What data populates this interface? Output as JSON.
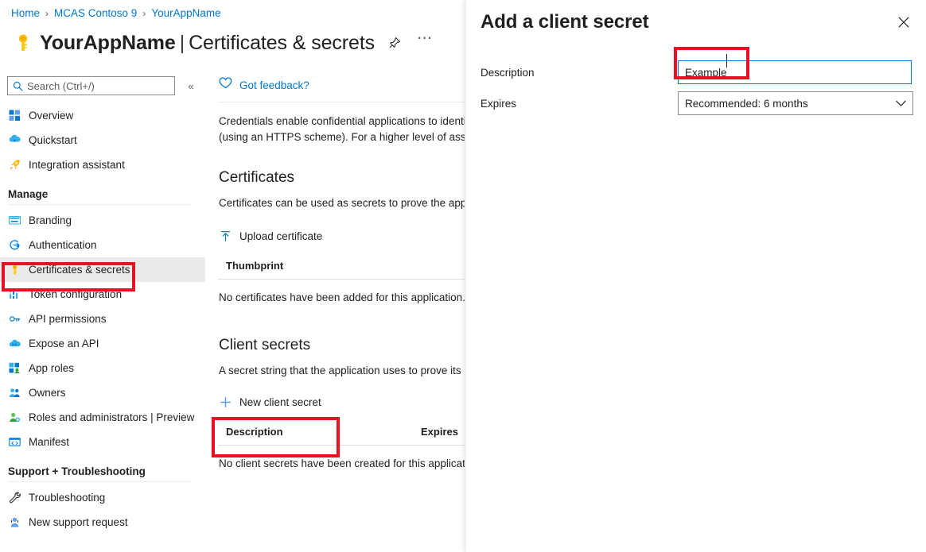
{
  "breadcrumb": [
    {
      "label": "Home"
    },
    {
      "label": "MCAS Contoso 9"
    },
    {
      "label": "YourAppName"
    }
  ],
  "breadcrumb_separator": "›",
  "header": {
    "app_name": "YourAppName",
    "divider": "|",
    "section": "Certificates & secrets"
  },
  "sidebar": {
    "search": {
      "placeholder": "Search (Ctrl+/)",
      "value": ""
    },
    "items": [
      {
        "label": "Overview",
        "icon": "overview-icon",
        "selected": false
      },
      {
        "label": "Quickstart",
        "icon": "quickstart-icon",
        "selected": false
      },
      {
        "label": "Integration assistant",
        "icon": "rocket-icon",
        "selected": false
      }
    ],
    "groups": [
      {
        "title": "Manage",
        "items": [
          {
            "label": "Branding",
            "icon": "branding-icon",
            "selected": false
          },
          {
            "label": "Authentication",
            "icon": "authentication-icon",
            "selected": false
          },
          {
            "label": "Certificates & secrets",
            "icon": "key-icon",
            "selected": true
          },
          {
            "label": "Token configuration",
            "icon": "token-icon",
            "selected": false
          },
          {
            "label": "API permissions",
            "icon": "api-permissions-icon",
            "selected": false
          },
          {
            "label": "Expose an API",
            "icon": "expose-api-icon",
            "selected": false
          },
          {
            "label": "App roles",
            "icon": "app-roles-icon",
            "selected": false
          },
          {
            "label": "Owners",
            "icon": "owners-icon",
            "selected": false
          },
          {
            "label": "Roles and administrators | Preview",
            "icon": "roles-admin-icon",
            "selected": false
          },
          {
            "label": "Manifest",
            "icon": "manifest-icon",
            "selected": false
          }
        ]
      },
      {
        "title": "Support + Troubleshooting",
        "items": [
          {
            "label": "Troubleshooting",
            "icon": "wrench-icon",
            "selected": false
          },
          {
            "label": "New support request",
            "icon": "support-agent-icon",
            "selected": false
          }
        ]
      }
    ]
  },
  "main": {
    "feedback_label": "Got feedback?",
    "intro_text": "Credentials enable confidential applications to identify\n(using an HTTPS scheme). For a higher level of assuran",
    "certificates": {
      "heading": "Certificates",
      "description": "Certificates can be used as secrets to prove the applica",
      "upload_label": "Upload certificate",
      "column_thumbprint": "Thumbprint",
      "empty_text": "No certificates have been added for this application."
    },
    "client_secrets": {
      "heading": "Client secrets",
      "description": "A secret string that the application uses to prove its id",
      "new_secret_label": "New client secret",
      "column_description": "Description",
      "column_expires": "Expires",
      "empty_text": "No client secrets have been created for this application"
    }
  },
  "panel": {
    "title": "Add a client secret",
    "close_icon": "close-icon",
    "description": {
      "label": "Description",
      "value": "Example",
      "placeholder": ""
    },
    "expires": {
      "label": "Expires",
      "selected": "Recommended: 6 months"
    }
  },
  "colors": {
    "accent_blue": "#0078d4",
    "highlight_red": "#e81123",
    "selected_row": "#edebe9",
    "text_primary": "#201f1e"
  }
}
